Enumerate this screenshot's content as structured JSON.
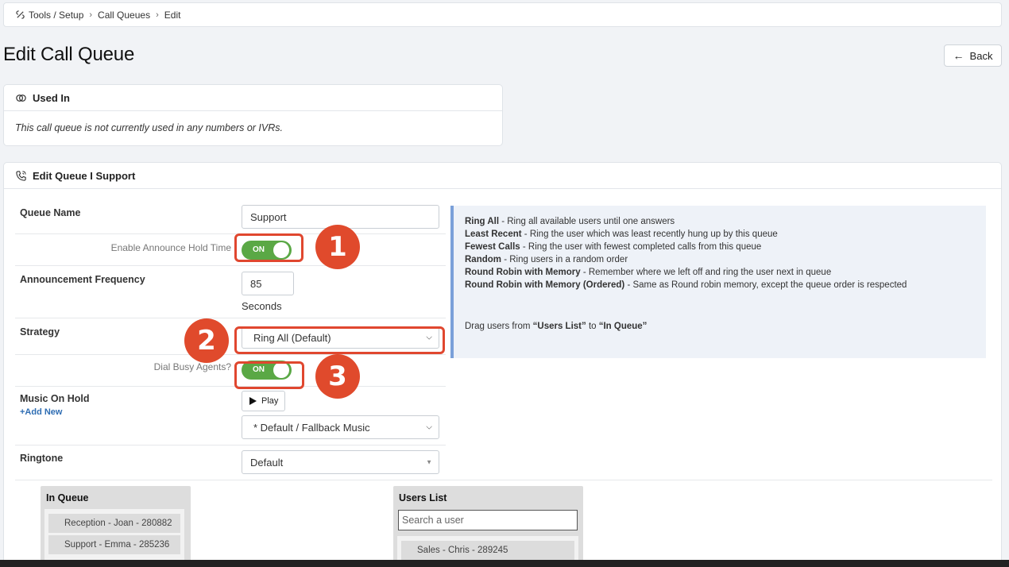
{
  "breadcrumb": {
    "item1": "Tools / Setup",
    "item2": "Call Queues",
    "item3": "Edit"
  },
  "page": {
    "title": "Edit Call Queue",
    "back_label": "Back"
  },
  "used_in": {
    "title": "Used In",
    "message": "This call queue is not currently used in any numbers or IVRs."
  },
  "edit_queue": {
    "title": "Edit Queue I Support",
    "queue_name_label": "Queue Name",
    "queue_name_value": "Support",
    "announce_hold_label": "Enable Announce Hold Time",
    "announce_hold_state": "ON",
    "announce_freq_label": "Announcement Frequency",
    "announce_freq_value": "85",
    "seconds_label": "Seconds",
    "strategy_label": "Strategy",
    "strategy_value": "Ring All (Default)",
    "dial_busy_label": "Dial Busy Agents?",
    "dial_busy_state": "ON",
    "moh_label": "Music On Hold",
    "add_new_label": "+Add New",
    "play_label": "Play",
    "moh_value": "* Default / Fallback Music",
    "ringtone_label": "Ringtone",
    "ringtone_value": "Default"
  },
  "info": {
    "lines": [
      {
        "term": "Ring All",
        "desc": " - Ring all available users until one answers"
      },
      {
        "term": "Least Recent",
        "desc": " - Ring the user which was least recently hung up by this queue"
      },
      {
        "term": "Fewest Calls",
        "desc": " - Ring the user with fewest completed calls from this queue"
      },
      {
        "term": "Random",
        "desc": " - Ring users in a random order"
      },
      {
        "term": "Round Robin with Memory",
        "desc": " - Remember where we left off and ring the user next in queue"
      },
      {
        "term": "Round Robin with Memory (Ordered)",
        "desc": " - Same as Round robin memory, except the queue order is respected"
      }
    ],
    "drag_prefix": "Drag users from ",
    "drag_users_list": "“Users List”",
    "drag_mid": " to ",
    "drag_in_queue": "“In Queue”"
  },
  "in_queue": {
    "title": "In Queue",
    "items": [
      "Reception - Joan - 280882",
      "Support - Emma - 285236"
    ]
  },
  "users_list": {
    "title": "Users List",
    "search_placeholder": "Search a user",
    "items": [
      "Sales - Chris - 289245"
    ]
  },
  "badges": [
    "1",
    "2",
    "3"
  ],
  "colors": {
    "toggle_on": "#5aa845",
    "highlight": "#e0472f",
    "badge": "#e04a2c",
    "info_border": "#7aa0d9"
  }
}
